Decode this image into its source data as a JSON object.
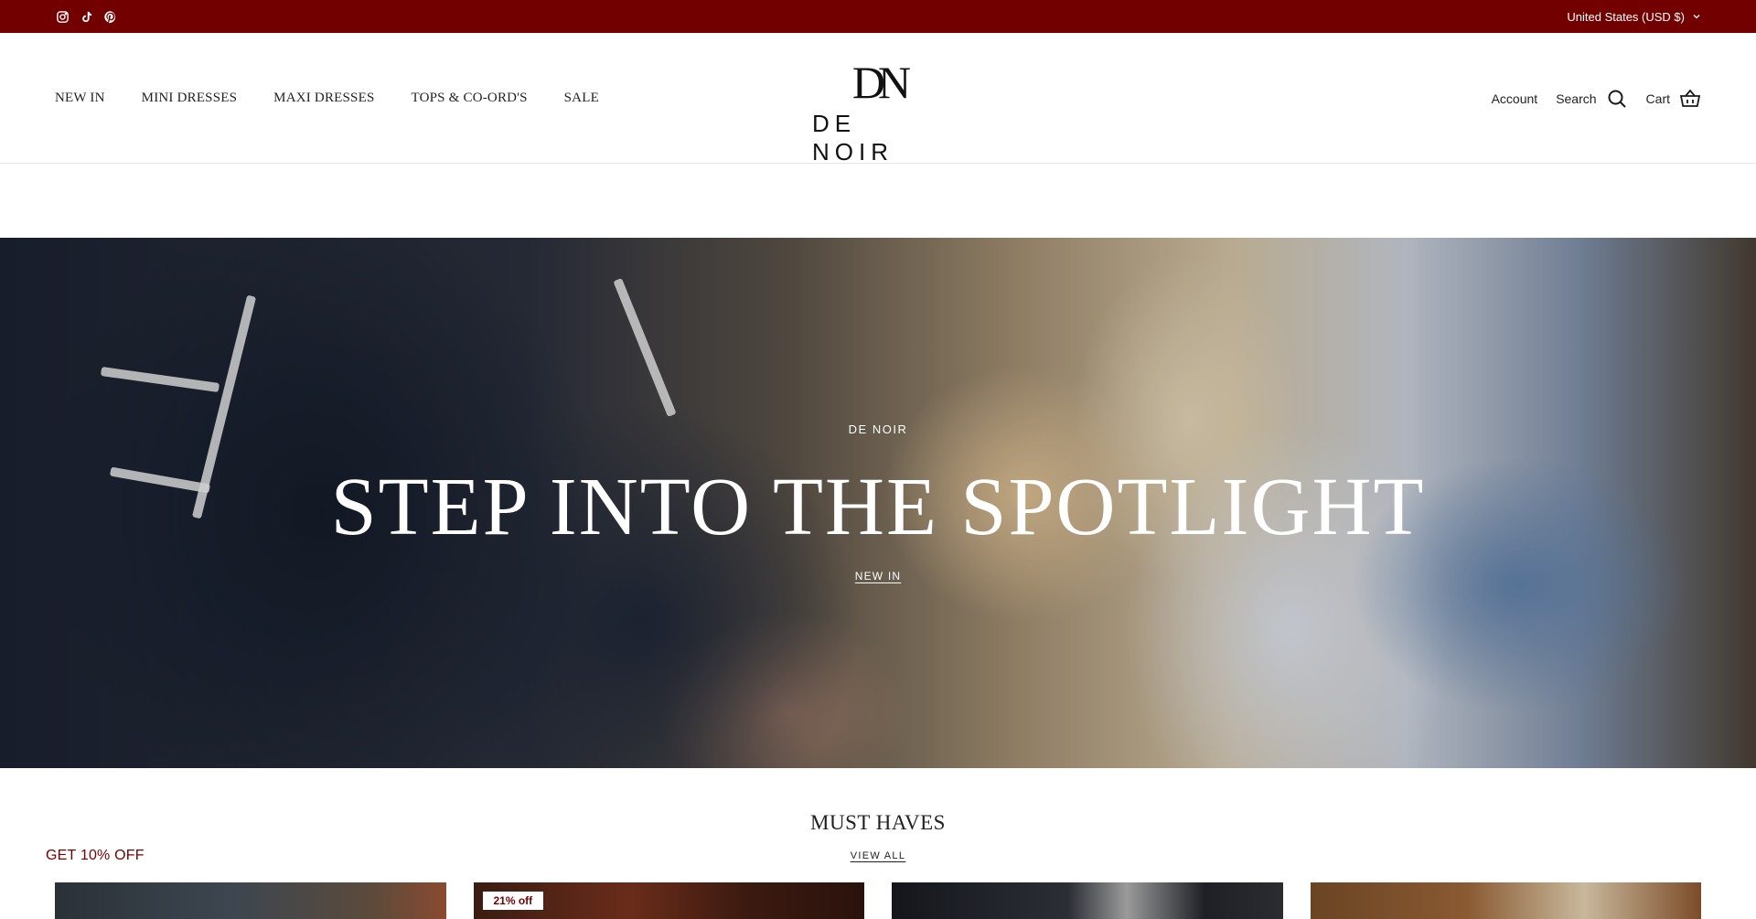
{
  "topbar": {
    "social": [
      "instagram-icon",
      "tiktok-icon",
      "pinterest-icon"
    ],
    "currency": "United States (USD $)",
    "background": "#730000"
  },
  "nav": {
    "items": [
      "NEW IN",
      "MINI DRESSES",
      "MAXI DRESSES",
      "TOPS & CO-ORD'S",
      "SALE"
    ]
  },
  "logo": {
    "mark": "DN",
    "text": "DE NOIR"
  },
  "header_actions": {
    "account": "Account",
    "search": "Search",
    "cart": "Cart"
  },
  "hero": {
    "kicker": "DE NOIR",
    "title": "STEP INTO THE SPOTLIGHT",
    "link": "NEW IN"
  },
  "must_haves": {
    "title": "MUST HAVES",
    "link": "VIEW ALL",
    "cards": [
      {
        "badge": ""
      },
      {
        "badge": "21% off"
      },
      {
        "badge": ""
      },
      {
        "badge": ""
      }
    ]
  },
  "promo": {
    "label": "GET 10% OFF"
  }
}
